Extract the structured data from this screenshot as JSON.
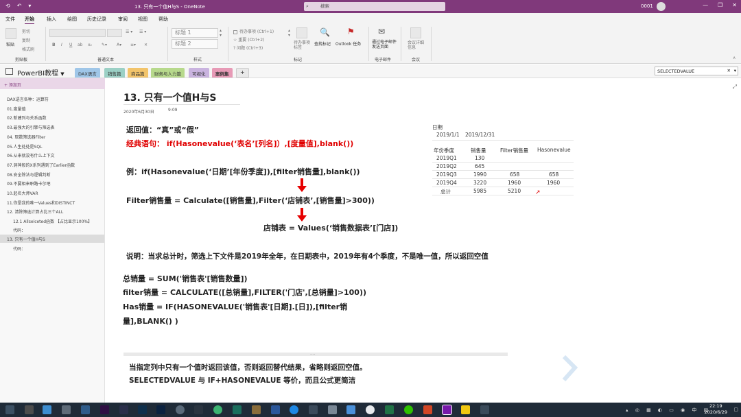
{
  "titlebar": {
    "title": "13. 只有一个值H与S  -  OneNote",
    "search_placeholder": "搜索",
    "user": "0001",
    "minimize": "—",
    "restore": "❐",
    "close": "✕"
  },
  "ribbon_tabs": [
    "文件",
    "开始",
    "插入",
    "绘图",
    "历史记录",
    "审阅",
    "视图",
    "帮助"
  ],
  "ribbon": {
    "paste": "粘贴",
    "cut": "剪切",
    "copy": "复制",
    "format_painter": "格式刷",
    "clipboard_group": "剪贴板",
    "basic_text_group": "普通文本",
    "heading1": "标题 1",
    "heading2": "标题 2",
    "styles_group": "样式",
    "tag_todo": "待办事项 (Ctrl+1)",
    "tag_important": "重要 (Ctrl+2)",
    "tag_question": "问题 (Ctrl+3)",
    "todo_tag_btn": "待办事项标签",
    "find_tags_btn": "查找标记",
    "outlook_tasks_btn": "Outlook 任务",
    "tags_group": "标记",
    "email_page_btn": "通过电子邮件发送页面",
    "email_group": "电子邮件",
    "meeting_btn": "会议详细信息",
    "meeting_group": "会议"
  },
  "notebook": {
    "title": "PowerBI教程",
    "sections": [
      {
        "label": "DAX语言",
        "color": "#9fc6e8"
      },
      {
        "label": "销售篇",
        "color": "#9bd0c5"
      },
      {
        "label": "商品篇",
        "color": "#f2c46b"
      },
      {
        "label": "财务与人力篇",
        "color": "#b7d98c"
      },
      {
        "label": "可视化",
        "color": "#c9b3df"
      },
      {
        "label": "案例集",
        "color": "#e79ab6"
      }
    ],
    "add_section": "+",
    "search_value": "SELECTEDVALUE"
  },
  "pages": {
    "add_page": "+ 添加页",
    "items": [
      "DAX语言各种：运算符",
      "01.度量值",
      "02.新建列与关系函数",
      "03.最强大的引擎与筛选表",
      "04. 取数筛选器Filter",
      "05.人生处处是SQL",
      "06.从来就没有什么上下文",
      "07.洞神般的X系列遇到了Earlier函数",
      "08.安全除法与逻辑判断",
      "09.不要相来职路卡尔吧",
      "10.起名大师VAR",
      "11.你是我的唯一Values和DISTINCT",
      "12. 清除筛选计算占比三个ALL",
      "12.1 Allselceted函数 【占比显示100%】",
      "代码：",
      "13. 只有一个值H与S",
      "代码："
    ]
  },
  "page": {
    "title": "13. 只有一个值H与S",
    "date": "2020年6月30日",
    "time": "9:09",
    "return_line": "返回值：“真”或“假”",
    "classic_label": "经典语句：",
    "classic_code": "if(Hasonevalue(‘表名’[列名]）,[度量值],blank())",
    "example": "例：if(Hasonevalue(‘日期’[年份季度]),[filter销售量],blank())",
    "filter_measure": "Filter销售量 = Calculate([销售量],Filter(‘店铺表’,[销售量]>300))",
    "store_table": "店铺表 = Values(‘销售数据表’[门店])",
    "explanation": "说明：当求总计时，筛选上下文件是2019年全年，在日期表中，2019年有4个季度，不是唯一值，所以返回空值",
    "code_lines": [
      "总销量 = SUM('销售表'[销售数量])",
      "filter销量 = CALCULATE([总销量],FILTER('门店',[总销量]>100))",
      "Has销量 = IF(HASONEVALUE('销售表'[日期].[日]),[filter销",
      "量],BLANK() )"
    ],
    "note_line1": "当指定列中只有一个值时返回该值，否则返回替代结果，省略则返回空值。",
    "note_line2": "SELECTEDVALUE 与 IF+HASONEVALUE 等价，而且公式更简洁"
  },
  "mini_table": {
    "date_label": "日期",
    "date_from": "2019/1/1",
    "date_to": "2019/12/31",
    "headers": [
      "年份季度",
      "销售量",
      "Filter销售量",
      "Hasonevalue"
    ],
    "rows": [
      [
        "2019Q1",
        "130",
        "",
        ""
      ],
      [
        "2019Q2",
        "645",
        "",
        ""
      ],
      [
        "2019Q3",
        "1990",
        "658",
        "658"
      ],
      [
        "2019Q4",
        "3220",
        "1960",
        "1960"
      ],
      [
        "总计",
        "5985",
        "5210",
        ""
      ]
    ]
  },
  "taskbar": {
    "time": "22:19",
    "date": "2020/6/29"
  }
}
